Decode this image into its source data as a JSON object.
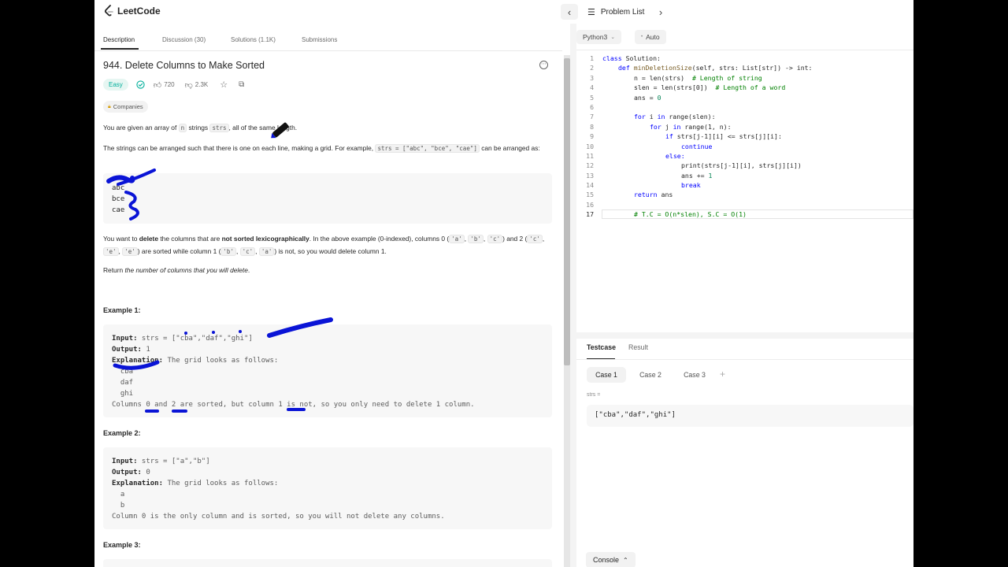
{
  "app": {
    "logo_text": "LeetCode",
    "problem_list": "Problem List"
  },
  "tabs": [
    "Description",
    "Discussion (30)",
    "Solutions (1.1K)",
    "Submissions"
  ],
  "problem": {
    "title": "944. Delete Columns to Make Sorted",
    "difficulty": "Easy",
    "likes": "720",
    "dislikes": "2.3K",
    "companies": "Companies",
    "p1": {
      "a": "You are given an array of ",
      "n": "n",
      "b": " strings ",
      "strs": "strs",
      "c": ", all of the same length."
    },
    "p2": {
      "a": "The strings can be arranged such that there is one on each line, making a grid. For example, ",
      "code": "strs = [\"abc\", \"bce\", \"cae\"]",
      "b": " can be arranged as:"
    },
    "grid": [
      "abc",
      "bce",
      "cae"
    ],
    "p3": {
      "a": "You want to ",
      "delete": "delete",
      "b": " the columns that are ",
      "notsorted": "not sorted lexicographically",
      "c": ". In the above example (0-indexed), columns 0 (",
      "c1": "'a'",
      "c2": "'b'",
      "c3": "'c'",
      "d": ") and 2 (",
      "d1": "'c'",
      "d2": "'e'",
      "d3": "'e'",
      "e": ") are sorted while column 1 (",
      "e1": "'b'",
      "e2": "'c'",
      "e3": "'a'",
      "f": ") is not, so you would delete column 1.",
      "sep": ", "
    },
    "p4": {
      "a": "Return ",
      "em": "the number of columns that you will delete",
      "b": "."
    },
    "examples": [
      {
        "title": "Example 1:",
        "input_label": "Input:",
        "input": " strs = [\"cba\",\"daf\",\"ghi\"]",
        "output_label": "Output:",
        "output": " 1",
        "expl_label": "Explanation:",
        "expl": " The grid looks as follows:",
        "rows": [
          "  cba",
          "  daf",
          "  ghi"
        ],
        "tail": "Columns 0 and 2 are sorted, but column 1 is not, so you only need to delete 1 column."
      },
      {
        "title": "Example 2:",
        "input_label": "Input:",
        "input": " strs = [\"a\",\"b\"]",
        "output_label": "Output:",
        "output": " 0",
        "expl_label": "Explanation:",
        "expl": " The grid looks as follows:",
        "rows": [
          "  a",
          "  b"
        ],
        "tail": "Column 0 is the only column and is sorted, so you will not delete any columns."
      },
      {
        "title": "Example 3:"
      }
    ]
  },
  "editor": {
    "language": "Python3",
    "mode": "Auto",
    "line_numbers": [
      "1",
      "2",
      "3",
      "4",
      "5",
      "6",
      "7",
      "8",
      "9",
      "10",
      "11",
      "12",
      "13",
      "14",
      "15",
      "16",
      "17"
    ],
    "code": {
      "l1a": "class ",
      "l1b": "Solution:",
      "l2a": "def ",
      "l2b": "minDeletionSize",
      "l2c": "(self, strs: List[str]) -> int:",
      "l3a": "n = len(strs)  ",
      "l3b": "# Length of string",
      "l4a": "slen = len(strs[0])  ",
      "l4b": "# Length of a word",
      "l5a": "ans = ",
      "l5b": "0",
      "l7a": "for ",
      "l7b": "i ",
      "l7c": "in ",
      "l7d": "range(slen):",
      "l8a": "for ",
      "l8b": "j ",
      "l8c": "in ",
      "l8d": "range(1, n):",
      "l9a": "if ",
      "l9b": "strs[j-1][i] <= strs[j][i]:",
      "l10": "continue",
      "l11": "else:",
      "l12": "print(strs[j-1][i], strs[j][i])",
      "l13a": "ans += ",
      "l13b": "1",
      "l14": "break",
      "l15a": "return ",
      "l15b": "ans",
      "l17": "# T.C = O(n*slen), S.C = O(1)"
    }
  },
  "testcase": {
    "tabs": [
      "Testcase",
      "Result"
    ],
    "cases": [
      "Case 1",
      "Case 2",
      "Case 3"
    ],
    "add": "+",
    "label": "strs =",
    "value": "[\"cba\",\"daf\",\"ghi\"]",
    "console": "Console"
  },
  "colors": {
    "easy": "#00af9b",
    "ink": "#0a14d6"
  }
}
